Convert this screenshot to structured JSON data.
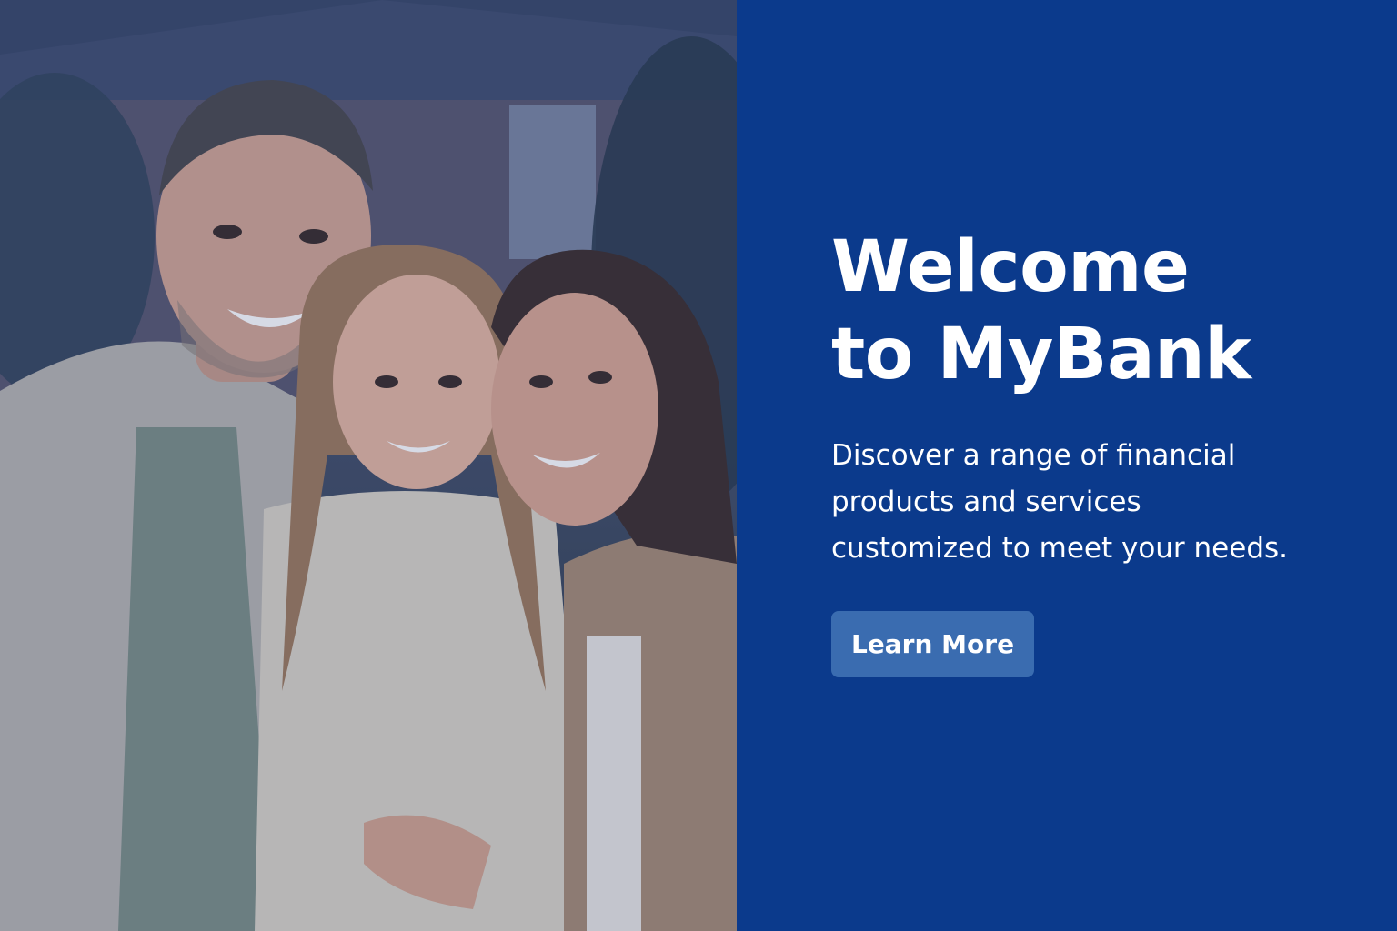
{
  "hero": {
    "headline_line1": "Welcome",
    "headline_line2": "to MyBank",
    "subtext_line1": "Discover a range of financial",
    "subtext_line2": "products and services",
    "subtext_line3": "customized to meet your needs.",
    "cta_label": "Learn More",
    "image_description_icon": "family-photo",
    "colors": {
      "panel_background": "#0b3a8c",
      "button_background": "#3a6cb0",
      "text": "#ffffff"
    }
  }
}
